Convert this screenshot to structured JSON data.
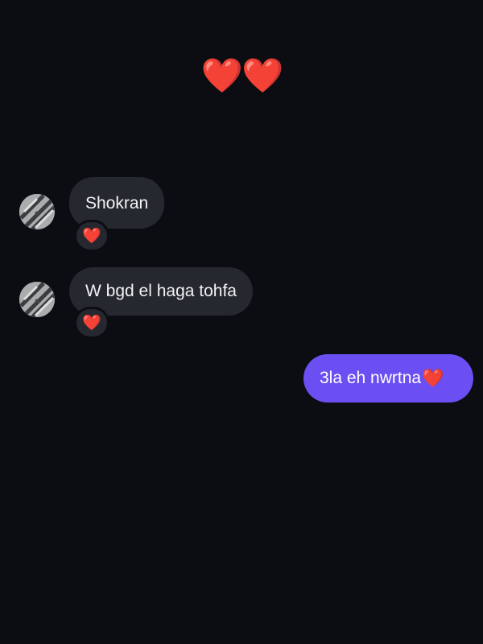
{
  "header": {
    "hearts": "❤️❤️"
  },
  "messages": [
    {
      "direction": "incoming",
      "text": "Shokran",
      "reaction": "❤️"
    },
    {
      "direction": "incoming",
      "text": "W bgd el haga tohfa",
      "reaction": "❤️"
    },
    {
      "direction": "outgoing",
      "text": "3la eh nwrtna",
      "emoji": "❤️"
    }
  ],
  "colors": {
    "background": "#0b0d12",
    "incoming_bubble": "#262830",
    "outgoing_bubble": "#6b4ff2",
    "heart": "#e0222a"
  }
}
